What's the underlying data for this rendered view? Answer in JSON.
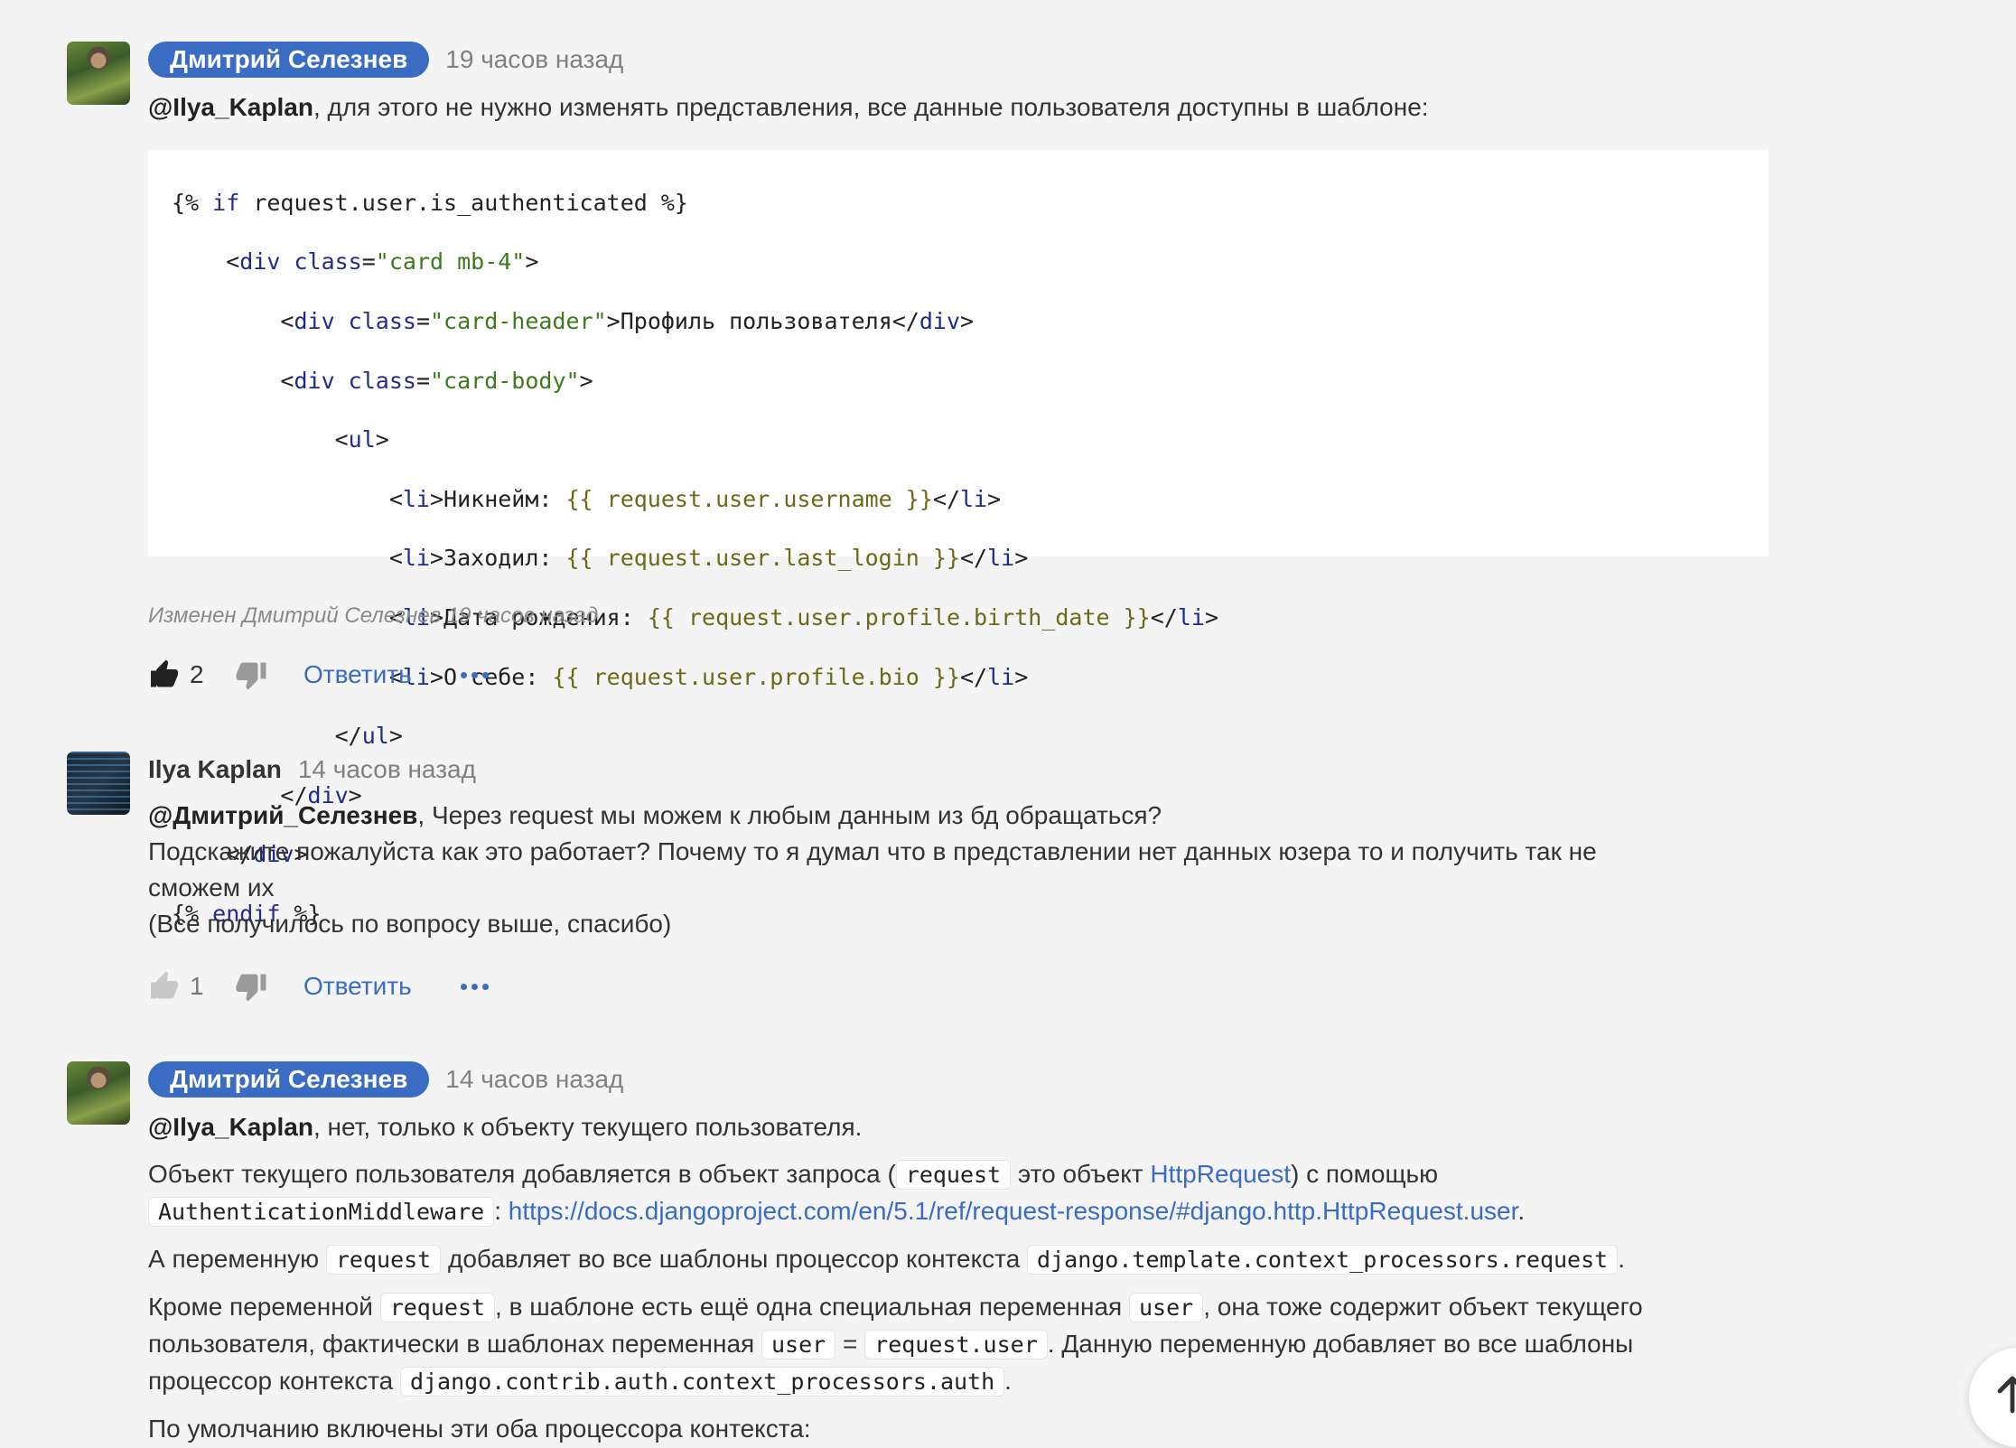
{
  "comments": [
    {
      "author": "Дмитрий Селезнев",
      "time": "19 часов назад",
      "mention": "@Ilya_Kaplan",
      "text": ", для этого не нужно изменять представления, все данные пользователя доступны в шаблоне:",
      "code": {
        "l1_a": "{% ",
        "l1_b": "if",
        "l1_c": " request.user.is_authenticated %}",
        "l2_a": "    <",
        "l2_b": "div",
        "l2_c": " class",
        "l2_d": "=",
        "l2_e": "\"card mb-4\"",
        "l2_f": ">",
        "l3_a": "        <",
        "l3_b": "div",
        "l3_c": " class",
        "l3_d": "=",
        "l3_e": "\"card-header\"",
        "l3_f": ">Профиль пользователя</",
        "l3_g": "div",
        "l3_h": ">",
        "l4_a": "        <",
        "l4_b": "div",
        "l4_c": " class",
        "l4_d": "=",
        "l4_e": "\"card-body\"",
        "l4_f": ">",
        "l5_a": "            <",
        "l5_b": "ul",
        "l5_c": ">",
        "l6_a": "                <",
        "l6_b": "li",
        "l6_c": ">Никнейм: ",
        "l6_d": "{{ request.user.username }}",
        "l6_e": "</",
        "l6_f": "li",
        "l6_g": ">",
        "l7_a": "                <",
        "l7_b": "li",
        "l7_c": ">Заходил: ",
        "l7_d": "{{ request.user.last_login }}",
        "l7_e": "</",
        "l7_f": "li",
        "l7_g": ">",
        "l8_a": "                <",
        "l8_b": "li",
        "l8_c": ">Дата рождения: ",
        "l8_d": "{{ request.user.profile.birth_date }}",
        "l8_e": "</",
        "l8_f": "li",
        "l8_g": ">",
        "l9_a": "                <",
        "l9_b": "li",
        "l9_c": ">О себе: ",
        "l9_d": "{{ request.user.profile.bio }}",
        "l9_e": "</",
        "l9_f": "li",
        "l9_g": ">",
        "l10_a": "            </",
        "l10_b": "ul",
        "l10_c": ">",
        "l11_a": "        </",
        "l11_b": "div",
        "l11_c": ">",
        "l12_a": "    </",
        "l12_b": "div",
        "l12_c": ">",
        "l13_a": "{% ",
        "l13_b": "endif",
        "l13_c": " %}"
      },
      "edited": "Изменен Дмитрий Селезнев 19 часов назад",
      "likes": "2",
      "reply": "Ответить"
    },
    {
      "author": "Ilya Kaplan",
      "time": "14 часов назад",
      "mention": "@Дмитрий_Селезнев",
      "line1": ", Через request мы можем к любым данным из бд обращаться?",
      "line2": "Подскажите пожалуйста как это работает? Почему то я думал что в представлении нет данных юзера то и получить так не",
      "line3": "сможем их",
      "line4": "(Все получилось по вопросу выше, спасибо)",
      "likes": "1",
      "reply": "Ответить"
    },
    {
      "author": "Дмитрий Селезнев",
      "time": "14 часов назад",
      "mention": "@Ilya_Kaplan",
      "line1": ", нет, только к объекту текущего пользователя.",
      "p2_a": "Объект текущего пользователя добавляется в объект запроса (",
      "p2_code1": "request",
      "p2_b": " это объект ",
      "p2_link1": "HttpRequest",
      "p2_c": ") с помощью",
      "p2_code2": "AuthenticationMiddleware",
      "p2_d": ": ",
      "p2_link2": "https://docs.djangoproject.com/en/5.1/ref/request-response/#django.http.HttpRequest.user",
      "p2_e": ".",
      "p3_a": "А переменную ",
      "p3_code1": "request",
      "p3_b": " добавляет во все шаблоны процессор контекста ",
      "p3_code2": "django.template.context_processors.request",
      "p3_c": ".",
      "p4_a": "Кроме переменной ",
      "p4_code1": "request",
      "p4_b": ", в шаблоне есть ещё одна специальная переменная ",
      "p4_code2": "user",
      "p4_c": ", она тоже содержит объект текущего",
      "p4_d": "пользователя, фактически в шаблонах переменная ",
      "p4_code3": "user",
      "p4_e": " = ",
      "p4_code4": "request.user",
      "p4_f": ". Данную переменную добавляет во все шаблоны",
      "p4_g": "процессор контекста ",
      "p4_code5": "django.contrib.auth.context_processors.auth",
      "p4_h": ".",
      "p5": "По умолчанию включены эти оба процессора контекста:"
    }
  ],
  "colors": {
    "accent": "#3a6cc4",
    "background": "#f4f4f4"
  },
  "icons": {
    "like": "thumbs-up-icon",
    "dislike": "thumbs-down-icon",
    "more": "more-dots-icon",
    "scroll": "arrow-up-icon"
  }
}
